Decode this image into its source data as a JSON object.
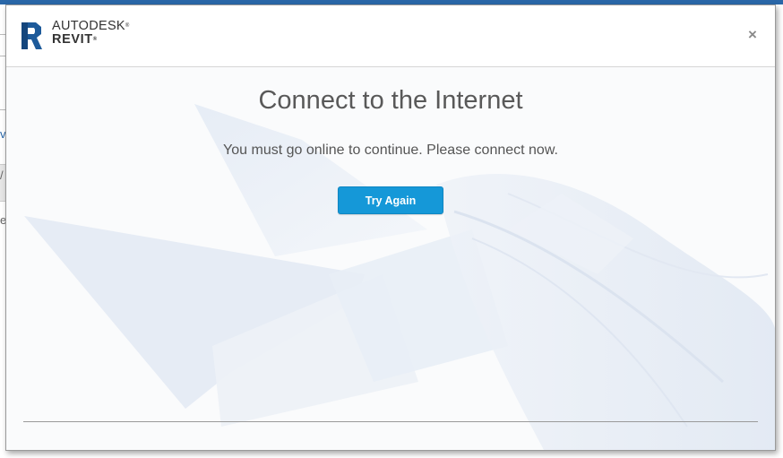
{
  "dialog": {
    "brand_line1": "AUTODESK",
    "brand_line2": "REVIT",
    "close_glyph": "×",
    "title": "Connect to the Internet",
    "message": "You must go online to continue. Please connect now.",
    "try_again_label": "Try Again"
  },
  "background_fragments": {
    "frag1": "v",
    "frag2": "/",
    "frag3": "e"
  },
  "icons": {
    "logo": "revit-r-logo-icon",
    "close": "close-icon"
  },
  "colors": {
    "button": "#1598d8",
    "title_text": "#595959",
    "logo_blue": "#1d5a9a",
    "top_accent": "#2a67a8"
  }
}
